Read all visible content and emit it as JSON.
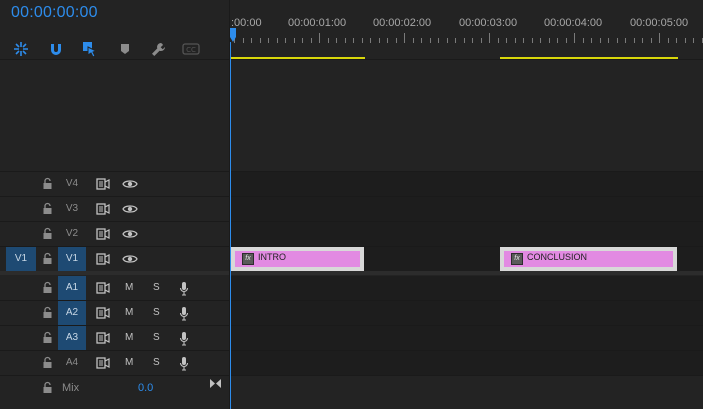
{
  "timecode": "00:00:00:00",
  "tools": [
    {
      "name": "nest-icon",
      "color": "#2d8ceb"
    },
    {
      "name": "snap-icon",
      "color": "#2d8ceb"
    },
    {
      "name": "linked-selection-icon",
      "color": "#2d8ceb"
    },
    {
      "name": "add-marker-icon",
      "color": "#8c8c8c"
    },
    {
      "name": "wrench-icon",
      "color": "#8c8c8c"
    },
    {
      "name": "captions-icon",
      "color": "#555555"
    }
  ],
  "ruler": {
    "labels": [
      ":00:00",
      "00:00:01:00",
      "00:00:02:00",
      "00:00:03:00",
      "00:00:04:00",
      "00:00:05:00"
    ]
  },
  "video_tracks": [
    {
      "id": "v4",
      "label": "V4",
      "targeted": false,
      "source_patch": ""
    },
    {
      "id": "v3",
      "label": "V3",
      "targeted": false,
      "source_patch": ""
    },
    {
      "id": "v2",
      "label": "V2",
      "targeted": false,
      "source_patch": ""
    },
    {
      "id": "v1",
      "label": "V1",
      "targeted": true,
      "source_patch": "V1"
    }
  ],
  "audio_tracks": [
    {
      "id": "a1",
      "label": "A1",
      "targeted": true,
      "mute": "M",
      "solo": "S"
    },
    {
      "id": "a2",
      "label": "A2",
      "targeted": true,
      "mute": "M",
      "solo": "S"
    },
    {
      "id": "a3",
      "label": "A3",
      "targeted": true,
      "mute": "M",
      "solo": "S"
    },
    {
      "id": "a4",
      "label": "A4",
      "targeted": false,
      "mute": "M",
      "solo": "S"
    }
  ],
  "clips": [
    {
      "id": "clip-intro",
      "label": "INTRO",
      "fx": "fx",
      "track": "V1"
    },
    {
      "id": "clip-conclusion",
      "label": "CONCLUSION",
      "fx": "fx",
      "track": "V1"
    }
  ],
  "mix": {
    "label": "Mix",
    "value": "0.0"
  },
  "colors": {
    "accent": "#2d8ceb",
    "clip_fill": "#e28ae2",
    "work_area": "#d8d60a",
    "target_bg": "#1e4a73"
  }
}
